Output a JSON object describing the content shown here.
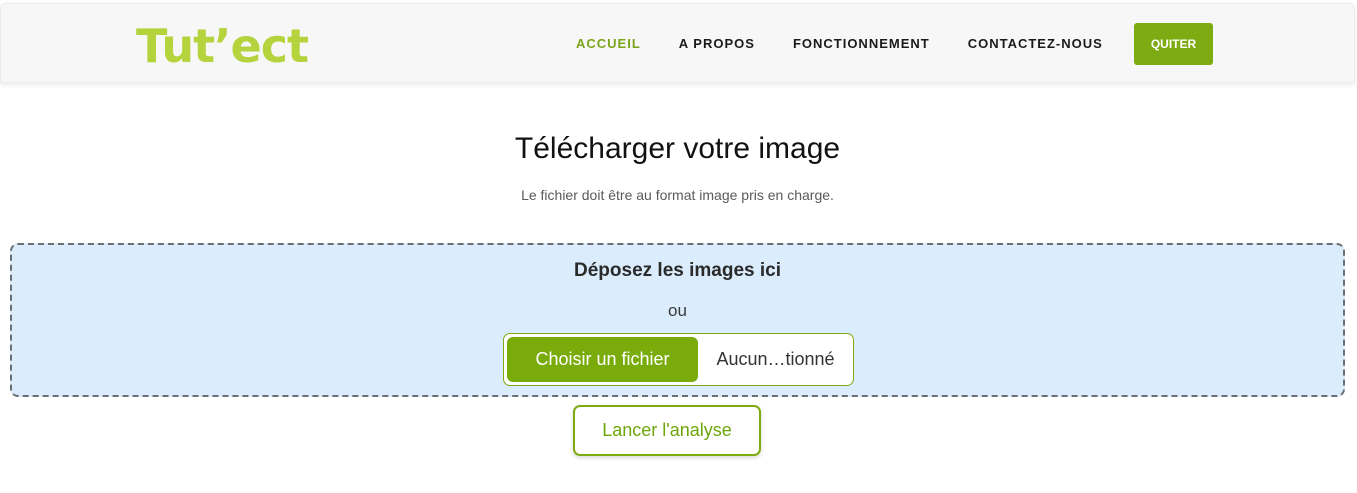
{
  "header": {
    "logo": "Tut’ect",
    "nav": [
      {
        "label": "ACCUEIL",
        "active": true
      },
      {
        "label": "A PROPOS",
        "active": false
      },
      {
        "label": "FONCTIONNEMENT",
        "active": false
      },
      {
        "label": "CONTACTEZ-NOUS",
        "active": false
      }
    ],
    "quit_label": "QUITER"
  },
  "main": {
    "title": "Télécharger votre image",
    "subtitle": "Le fichier doit être au format image pris en charge.",
    "dropzone": {
      "title": "Déposez les images ici",
      "or": "ou",
      "choose_label": "Choisir un fichier",
      "file_status": "Aucun…tionné"
    },
    "analyse_label": "Lancer l'analyse"
  },
  "colors": {
    "accent": "#7fab12",
    "logo": "#b5d33d",
    "dropzone_bg": "#dbecfc"
  }
}
